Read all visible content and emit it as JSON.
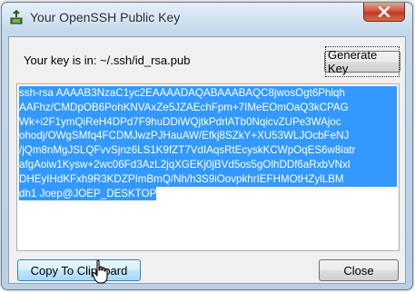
{
  "window": {
    "title": "Your OpenSSH Public Key",
    "title_icon": "ssh-key-icon",
    "close_icon": "close-x-icon"
  },
  "key_label": "Your key is in: ~/.ssh/id_rsa.pub",
  "buttons": {
    "generate": "Generate Key",
    "copy": "Copy To Clipboard",
    "close": "Close"
  },
  "key_lines": [
    "ssh-rsa AAAAB3NzaC1yc2EAAAADAQABAAABAQC8jwosOgt6Phlqh",
    "AAFhz/CMDpOB6PohKNVAxZe5JZAEchFpm+7IMeEOmOaQ3kCPAG",
    "Wk+i2F1ymQiReH4DPd7F9huDDiWQjtkPdrlATb0NqicvZUPe3WAjoc",
    "ohodj/OWgSMfq4FCDMJwzPJHauAW/Efkj8SZkY+XU53WLJOcbFeNJ",
    "/jQm8nMgJSLQFvvSjnz6LS1K9fZT7VdIAqsRtEcyskKCWpOqES6w8iatr",
    "afgAoiw1Kysw+2wc06Fd3AzL2jqXGEKj0jBVd5os5gOlhDDf6aRxbVNxl",
    "DHEyIHdKFxh9R3KDZPImBmQ/Nh/h3S9iOovpkhrIEFHMOtHZylLBM",
    "dh1 Joep@JOEP_DESKTOP"
  ],
  "colors": {
    "selection": "#3399ff",
    "close_button": "#c23a24"
  }
}
